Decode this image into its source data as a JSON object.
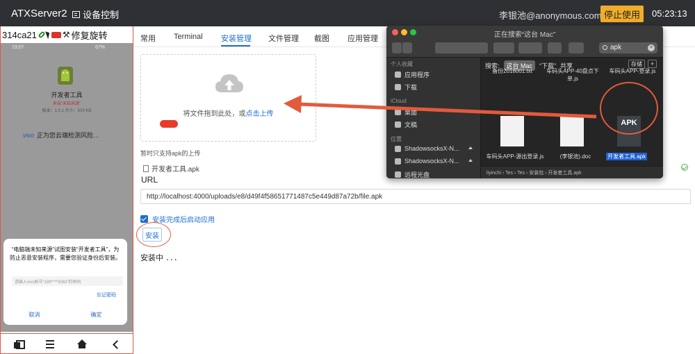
{
  "navbar": {
    "brand": "ATXServer2",
    "device_control": "设备控制",
    "user": "李银池@anonymous.com",
    "stop_button": "停止使用",
    "time": "05:23:13"
  },
  "device": {
    "id": "314ca21",
    "rotate_label": "修复旋转",
    "phone": {
      "status_time": "23:07",
      "status_right": "67%",
      "app_name": "开发者工具",
      "app_source": "来自“未知来源”",
      "app_meta": "版本：1.0.1 大小：503 KB",
      "vivo_brand": "vivo",
      "scan_text": "正为您云端检测风险…",
      "dialog": {
        "message": "“电脑端未知来源”试图安装“开发者工具”，为防止恶意安装程序，需要您验证身份后安装。",
        "input_placeholder": "请输入vivo账号“189****3063”的密码",
        "forgot": "忘记密码",
        "cancel": "取消",
        "confirm": "确定"
      }
    }
  },
  "tabs": [
    "常用",
    "Terminal",
    "安装管理",
    "文件管理",
    "截图",
    "应用管理"
  ],
  "active_tab": "安装管理",
  "upload": {
    "drop_text": "将文件拖到此处，或",
    "upload_link": "点击上传",
    "note": "暂时只支持apk的上传",
    "file_name": "开发者工具.apk"
  },
  "url": {
    "label": "URL",
    "value": "http://localhost:4000/uploads/e8/d49f4f58651771487c5e449d87a72b/file.apk"
  },
  "auto_launch_label": "安装完成后启动应用",
  "install_button": "安装",
  "status_text": "安装中",
  "status_dots": "...",
  "finder": {
    "title": "正在搜索“这台 Mac”",
    "search_value": "apk",
    "scope_label": "搜索:",
    "scope_this_mac": "这台 Mac",
    "scope_downloads": "“下载”",
    "scope_shared": "共享",
    "save_label": "存储",
    "sidebar": {
      "section_favorites": "个人收藏",
      "apps": "应用程序",
      "downloads": "下载",
      "section_icloud": "iCloud",
      "desktop": "桌面",
      "documents": "文稿",
      "section_locations": "位置",
      "loc1": "ShadowsocksX-N...",
      "loc2": "ShadowsocksX-N...",
      "loc3": "远程光盘"
    },
    "files": {
      "f1_top": "备份2018001.txt",
      "f2_top": "车码头APP-40盘点下单.js",
      "f3_top": "车码头APP-登录.js",
      "f4": "车码头APP-源出登录.js",
      "f5": "(李银池).doc",
      "f6": "开发者工具.apk"
    },
    "apk_thumb_label": "APK",
    "path": "liyinchi › Tes › Tes › 安装包 › 开发者工具.apk"
  }
}
